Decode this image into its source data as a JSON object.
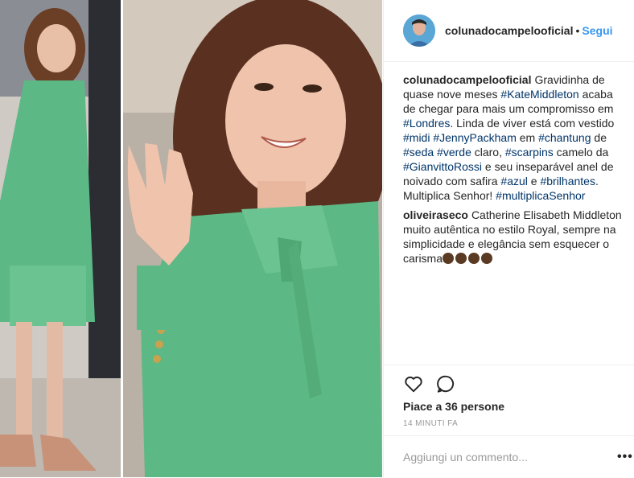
{
  "post": {
    "username": "colunadocampelooficial",
    "follow_label": "Segui",
    "separator": "•"
  },
  "caption": {
    "username": "colunadocampelooficial",
    "segments": [
      {
        "t": "Gravidinha de quase nove meses ",
        "tag": false
      },
      {
        "t": "#KateMiddleton",
        "tag": true
      },
      {
        "t": " acaba de chegar para mais um compromisso em ",
        "tag": false
      },
      {
        "t": "#Londres",
        "tag": true
      },
      {
        "t": ". Linda de viver está com vestido ",
        "tag": false
      },
      {
        "t": "#midi",
        "tag": true
      },
      {
        "t": " ",
        "tag": false
      },
      {
        "t": "#JennyPackham",
        "tag": true
      },
      {
        "t": " em ",
        "tag": false
      },
      {
        "t": "#chantung",
        "tag": true
      },
      {
        "t": " de ",
        "tag": false
      },
      {
        "t": "#seda",
        "tag": true
      },
      {
        "t": " ",
        "tag": false
      },
      {
        "t": "#verde",
        "tag": true
      },
      {
        "t": " claro, ",
        "tag": false
      },
      {
        "t": "#scarpins",
        "tag": true
      },
      {
        "t": " camelo da ",
        "tag": false
      },
      {
        "t": "#GianvittoRossi",
        "tag": true
      },
      {
        "t": " e seu inseparável anel de noivado com safira ",
        "tag": false
      },
      {
        "t": "#azul",
        "tag": true
      },
      {
        "t": " e ",
        "tag": false
      },
      {
        "t": "#brilhantes",
        "tag": true
      },
      {
        "t": ". Multiplica Senhor! ",
        "tag": false
      },
      {
        "t": "#multiplicaSenhor",
        "tag": true
      }
    ]
  },
  "comments": [
    {
      "username": "oliveiraseco",
      "text": "Catherine Elisabeth Middleton muito autêntica no estilo Royal, sempre na simplicidade e elegância sem esquecer o carisma",
      "emoji_count": 4,
      "emoji_icon": "clapping-hands-icon"
    }
  ],
  "actions": {
    "like_icon": "heart-icon",
    "comment_icon": "comment-bubble-icon",
    "likes_text": "Piace a 36 persone",
    "time_text": "14 minuti fa"
  },
  "add_comment": {
    "placeholder": "Aggiungi un commento...",
    "more_label": "•••"
  },
  "colors": {
    "accent": "#3897f0",
    "hashtag": "#003569",
    "dress_green": "#5cb884",
    "meta_gray": "#999999"
  }
}
